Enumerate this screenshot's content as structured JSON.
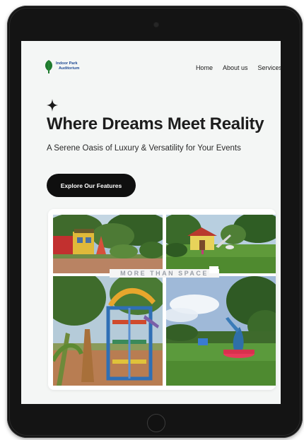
{
  "brand": {
    "logo_line1": "Indoor Park",
    "logo_line2": "Auditorium",
    "logo_icon": "leaf-icon",
    "brand_color": "#1f4a94",
    "leaf_color": "#1f7a2e"
  },
  "nav": {
    "items": [
      "Home",
      "About us",
      "Services"
    ]
  },
  "hero": {
    "icon": "sparkle-icon",
    "title": "Where Dreams Meet Reality",
    "subtitle": "A Serene Oasis of Luxury & Versatility for Your Events",
    "cta_label": "Explore Our Features"
  },
  "gallery": {
    "overlay_text": "MORE THAN SPACE",
    "photos": [
      "red-yellow-building",
      "garden-hut-slide",
      "playground-climber",
      "lawn-sculpture"
    ]
  },
  "colors": {
    "screen_bg": "#f4f6f5",
    "button_bg": "#0f0f0f",
    "text_primary": "#1d1d1d"
  }
}
